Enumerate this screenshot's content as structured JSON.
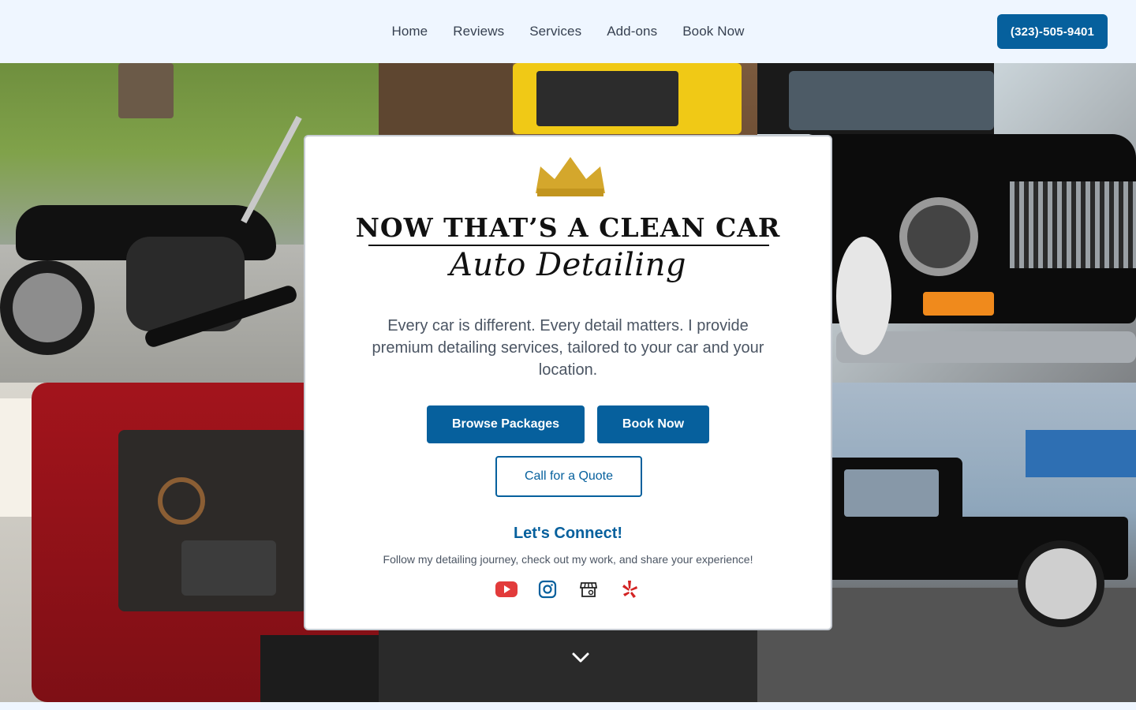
{
  "nav": {
    "items": [
      {
        "label": "Home"
      },
      {
        "label": "Reviews"
      },
      {
        "label": "Services"
      },
      {
        "label": "Add-ons"
      },
      {
        "label": "Book Now"
      }
    ],
    "phone": "(323)-505-9401"
  },
  "hero": {
    "logo_line1": "NOW THAT’S A CLEAN CAR",
    "logo_line2": "Auto Detailing",
    "tagline": "Every car is different. Every detail matters. I provide premium detailing services, tailored to your car and your location.",
    "browse_button": "Browse Packages",
    "book_button": "Book Now",
    "quote_button": "Call for a Quote",
    "connect_title": "Let's Connect!",
    "connect_subtitle": "Follow my detailing journey, check out my work, and share your experience!"
  },
  "socials": [
    {
      "icon": "youtube-icon"
    },
    {
      "icon": "instagram-icon"
    },
    {
      "icon": "google-business-icon"
    },
    {
      "icon": "yelp-icon"
    }
  ],
  "colors": {
    "brand": "#06609d",
    "header_bg": "#eff6ff",
    "crown": "#d4a72c",
    "youtube": "#e23b3b",
    "yelp": "#d32323"
  }
}
